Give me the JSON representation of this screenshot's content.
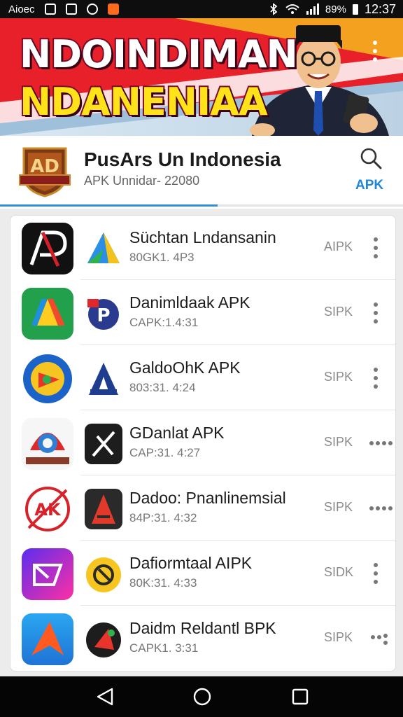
{
  "status_bar": {
    "carrier": "Aioec",
    "battery": "89%",
    "time": "12:37"
  },
  "banner": {
    "line1": "NDOINDIMAN",
    "line2": "NDANENIAA"
  },
  "header": {
    "title": "PusArs Un Indonesia",
    "subtitle": "APK Unnidar- 22080",
    "apk_label": "APK",
    "progress_fraction": 0.54
  },
  "apps": [
    {
      "name": "Süchtan Lndansanin",
      "version": "80GK1. 4P3",
      "tag": "AIPK",
      "menu": "vertical"
    },
    {
      "name": "Danimldaak APK",
      "version": "CAPK:1.4:31",
      "tag": "SIPK",
      "menu": "vertical"
    },
    {
      "name": "GaldoOhK APK",
      "version": "803:31. 4:24",
      "tag": "SIPK",
      "menu": "vertical"
    },
    {
      "name": "GDanlat APK",
      "version": "CAP:31. 4:27",
      "tag": "SIPK",
      "menu": "horizontal"
    },
    {
      "name": "Dadoo: Pnanlinemsial",
      "version": "84P:31. 4:32",
      "tag": "SIPK",
      "menu": "horizontal"
    },
    {
      "name": "Dafiormtaal AIPK",
      "version": "80K:31. 4:33",
      "tag": "SIDK",
      "menu": "vertical"
    },
    {
      "name": "Daidm Reldantl BPK",
      "version": "CAPK1. 3:31",
      "tag": "SIPK",
      "menu": "dots"
    }
  ],
  "colors": {
    "accent": "#2f8fd9",
    "banner_red": "#e8202a",
    "banner_yellow": "#ffe21a"
  }
}
